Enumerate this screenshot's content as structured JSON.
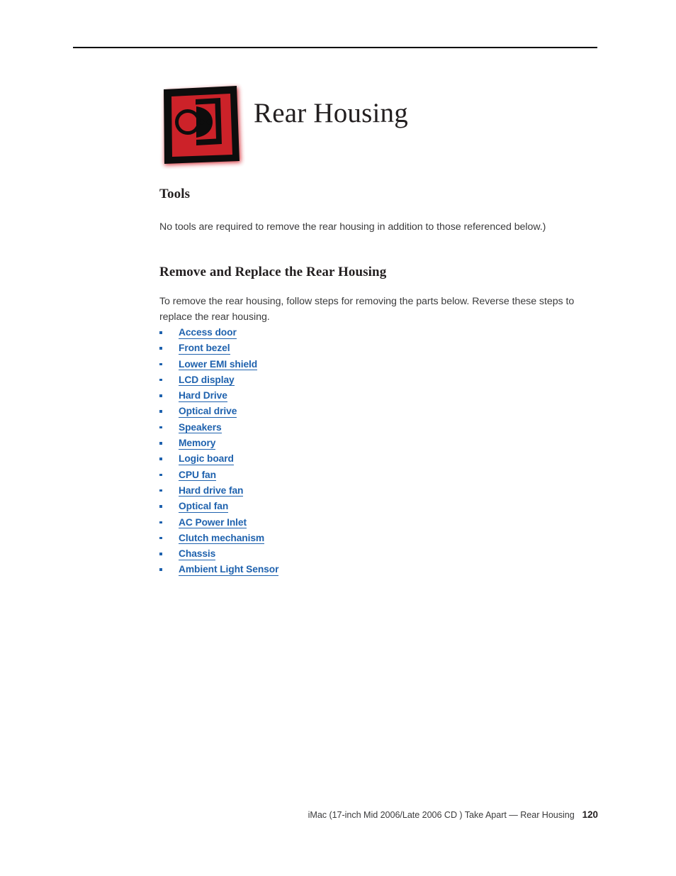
{
  "document": {
    "title": "Rear Housing",
    "logo_icon": "apple-service-source-red-square-logo",
    "logo_colors": {
      "red": "#CC2229",
      "black": "#0d0d0d"
    },
    "link_color": "#1F62AE",
    "rule_color": "#000000"
  },
  "sections": [
    {
      "heading": "Tools",
      "paragraph": "No tools are required to remove the rear housing in addition to those referenced below.)"
    },
    {
      "heading": "Remove and Replace the Rear Housing",
      "paragraph": "To remove the rear housing, follow steps for removing the parts below.  Reverse these steps to replace the rear housing."
    }
  ],
  "parts_links": [
    "Access door",
    "Front bezel",
    "Lower EMI shield",
    "LCD display",
    "Hard Drive",
    "Optical drive",
    "Speakers",
    "Memory",
    "Logic board",
    "CPU fan",
    "Hard drive fan",
    "Optical fan",
    "AC Power Inlet",
    "Clutch mechanism",
    "Chassis",
    "Ambient Light Sensor"
  ],
  "footer": {
    "text": "iMac (17-inch Mid 2006/Late 2006 CD ) Take Apart — Rear Housing",
    "page_number": "120"
  }
}
